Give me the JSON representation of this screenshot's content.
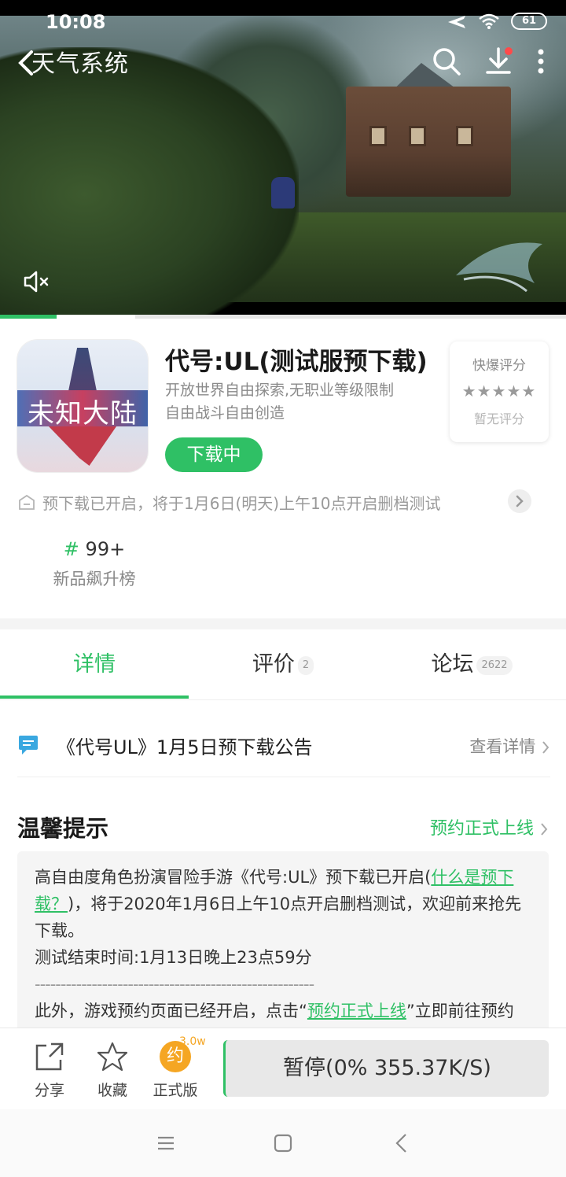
{
  "status_bar": {
    "time": "10:08",
    "battery": "61"
  },
  "hero": {
    "title": "天气系统",
    "icons": [
      "back-chevron-icon",
      "search-icon",
      "download-icon",
      "more-vertical-icon",
      "mute-icon"
    ],
    "video_progress": 0.1
  },
  "app": {
    "name": "代号:UL(测试服预下载)",
    "desc_line1": "开放世界自由探索,无职业等级限制",
    "desc_line2": "自由战斗自由创造",
    "download_label": "下载中",
    "icon_text": "未知大陆"
  },
  "rating": {
    "title": "快爆评分",
    "stars": "★★★★★",
    "none_text": "暂无评分"
  },
  "notice": "预下载已开启，将于1月6日(明天)上午10点开启删档测试",
  "rank": {
    "number": "99+",
    "label": "新品飙升榜"
  },
  "tabs": [
    {
      "label": "详情",
      "count": ""
    },
    {
      "label": "评价",
      "count": "2"
    },
    {
      "label": "论坛",
      "count": "2622"
    }
  ],
  "announcement": {
    "title": "《代号UL》1月5日预下载公告",
    "more": "查看详情"
  },
  "tip_section": {
    "title": "温馨提示",
    "link": "预约正式上线",
    "p1_pre": "高自由度角色扮演冒险手游《代号:UL》预下载已开启(",
    "p1_link": "什么是预下载？",
    "p1_post": ")，将于2020年1月6日上午10点开启删档测试，欢迎前来抢先下载。",
    "p2": "测试结束时间:1月13日晚上23点59分",
    "divider": "------------------------------------------------------",
    "p3_pre": "此外，游戏预约页面已经开启，点击“",
    "p3_link": "预约正式上线",
    "p3_post": "”立即前往预约"
  },
  "bottom_bar": {
    "share": "分享",
    "favorite": "收藏",
    "official": "正式版",
    "yue": "约",
    "yue_badge": "3.0w",
    "pause": "暂停(0%  355.37K/S)"
  },
  "colors": {
    "accent": "#2fc065",
    "orange": "#f5a623",
    "text_gray": "#8a8a8a"
  }
}
